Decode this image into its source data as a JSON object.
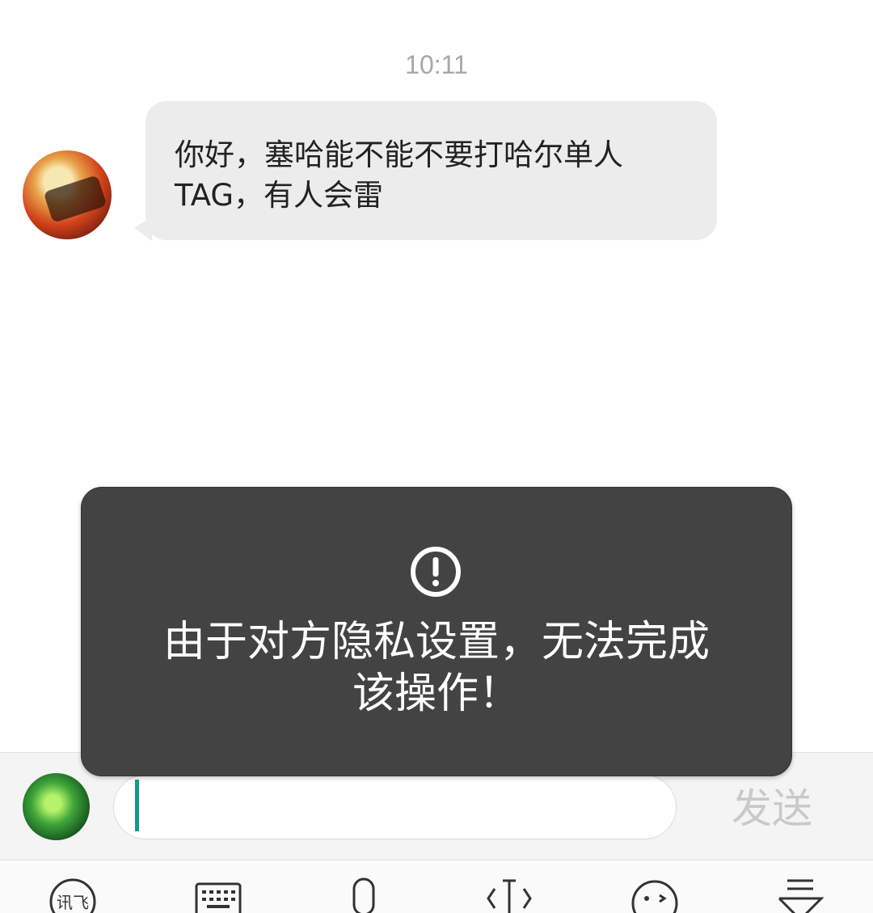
{
  "chat": {
    "timestamp": "10:11",
    "message_line1": "你好，塞哈能不能不要打哈尔单人",
    "message_line2": "TAG，有人会雷"
  },
  "toast": {
    "line1": "由于对方隐私设置，无法完成",
    "line2": "该操作！",
    "icon": "alert-circle-icon"
  },
  "input": {
    "value": "",
    "send_label": "发送"
  },
  "keyboard_toolbar": {
    "items": [
      {
        "icon": "ifly-logo-icon",
        "label": "讯飞"
      },
      {
        "icon": "keyboard-icon"
      },
      {
        "icon": "microphone-icon"
      },
      {
        "icon": "cursor-move-icon"
      },
      {
        "icon": "emoji-icon"
      },
      {
        "icon": "collapse-keyboard-icon"
      }
    ]
  },
  "colors": {
    "accent_caret": "#129a8a",
    "toast_bg": "#434343",
    "bubble_bg": "#ececec"
  }
}
